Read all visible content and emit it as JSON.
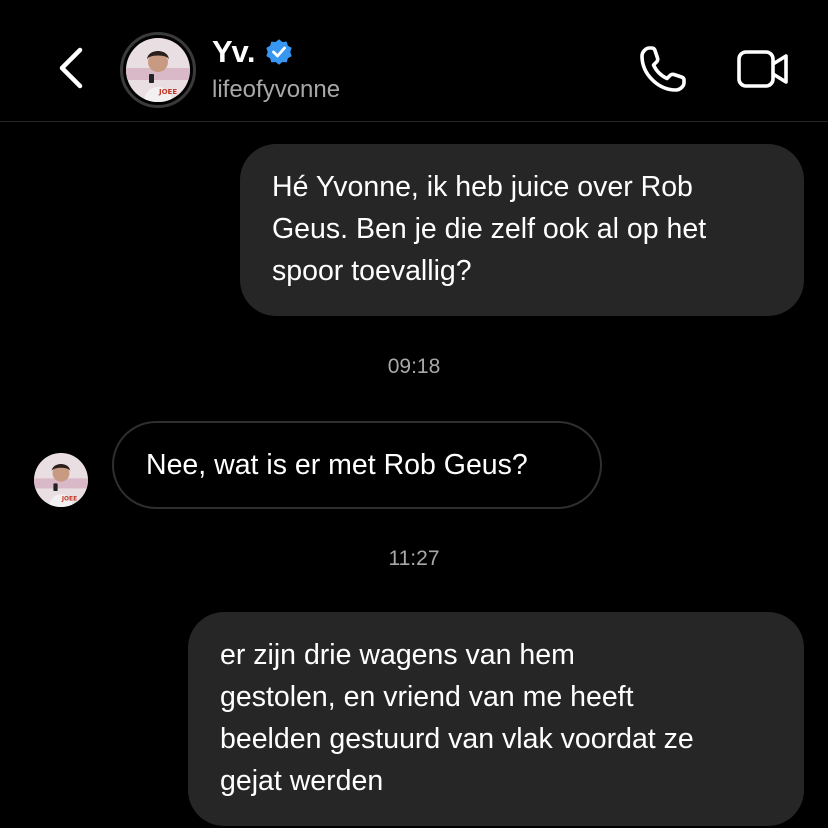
{
  "header": {
    "contact_name": "Yv.",
    "contact_handle": "lifeofyvonne",
    "verified": true,
    "icons": {
      "back": "chevron-left-icon",
      "call": "phone-icon",
      "video": "video-camera-icon",
      "verified": "verified-badge-icon"
    }
  },
  "colors": {
    "background": "#000000",
    "outgoing_bubble": "#262626",
    "incoming_bubble_border": "#2f2f2f",
    "secondary_text": "#a8a8a8",
    "verified_blue": "#3897f0"
  },
  "messages": [
    {
      "direction": "outgoing",
      "lines": [
        "Hé Yvonne, ik heb juice over Rob",
        "Geus. Ben je die zelf ook al op het",
        "spoor toevallig?"
      ]
    },
    {
      "type": "timestamp",
      "text": "09:18"
    },
    {
      "direction": "incoming",
      "lines": [
        "Nee, wat is er met Rob Geus?"
      ]
    },
    {
      "type": "timestamp",
      "text": "11:27"
    },
    {
      "direction": "outgoing",
      "lines": [
        "er zijn drie wagens van hem",
        "gestolen, en vriend van me heeft",
        "beelden gestuurd van vlak voordat ze",
        "gejat werden"
      ]
    }
  ]
}
